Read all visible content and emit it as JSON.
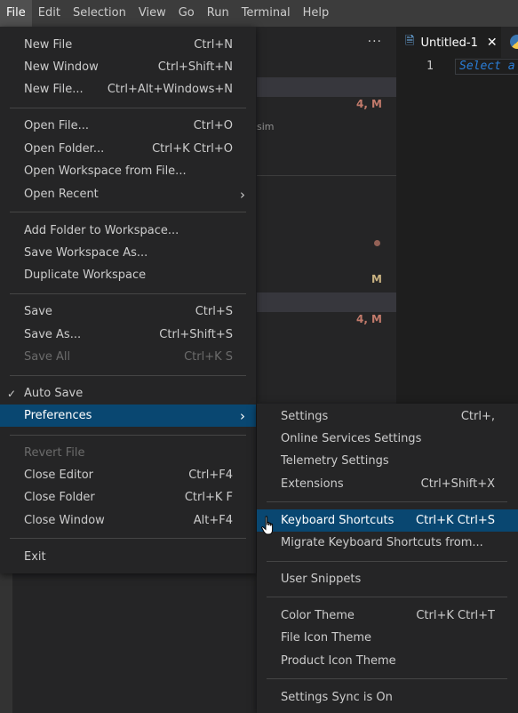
{
  "menubar": {
    "items": [
      "File",
      "Edit",
      "Selection",
      "View",
      "Go",
      "Run",
      "Terminal",
      "Help"
    ]
  },
  "sidebar": {
    "more_icon": "ellipsis-icon",
    "fragment": "sim",
    "badges": {
      "b1": "4, M",
      "b2": "M",
      "b3": "4, M"
    }
  },
  "editor": {
    "tab_title": "Untitled-1",
    "tab_icon": "file-icon",
    "line_number": "1",
    "placeholder": "Select a"
  },
  "file_menu": {
    "new_file": {
      "label": "New File",
      "shortcut": "Ctrl+N"
    },
    "new_window": {
      "label": "New Window",
      "shortcut": "Ctrl+Shift+N"
    },
    "new_file_dots": {
      "label": "New File...",
      "shortcut": "Ctrl+Alt+Windows+N"
    },
    "open_file": {
      "label": "Open File...",
      "shortcut": "Ctrl+O"
    },
    "open_folder": {
      "label": "Open Folder...",
      "shortcut": "Ctrl+K Ctrl+O"
    },
    "open_workspace": {
      "label": "Open Workspace from File...",
      "shortcut": ""
    },
    "open_recent": {
      "label": "Open Recent",
      "shortcut": ""
    },
    "add_folder": {
      "label": "Add Folder to Workspace...",
      "shortcut": ""
    },
    "save_workspace_as": {
      "label": "Save Workspace As...",
      "shortcut": ""
    },
    "duplicate_workspace": {
      "label": "Duplicate Workspace",
      "shortcut": ""
    },
    "save": {
      "label": "Save",
      "shortcut": "Ctrl+S"
    },
    "save_as": {
      "label": "Save As...",
      "shortcut": "Ctrl+Shift+S"
    },
    "save_all": {
      "label": "Save All",
      "shortcut": "Ctrl+K S"
    },
    "auto_save": {
      "label": "Auto Save",
      "shortcut": ""
    },
    "preferences": {
      "label": "Preferences",
      "shortcut": ""
    },
    "revert_file": {
      "label": "Revert File",
      "shortcut": ""
    },
    "close_editor": {
      "label": "Close Editor",
      "shortcut": "Ctrl+F4"
    },
    "close_folder": {
      "label": "Close Folder",
      "shortcut": "Ctrl+K F"
    },
    "close_window": {
      "label": "Close Window",
      "shortcut": "Alt+F4"
    },
    "exit": {
      "label": "Exit",
      "shortcut": ""
    }
  },
  "preferences_menu": {
    "settings": {
      "label": "Settings",
      "shortcut": "Ctrl+,"
    },
    "online_services": {
      "label": "Online Services Settings",
      "shortcut": ""
    },
    "telemetry": {
      "label": "Telemetry Settings",
      "shortcut": ""
    },
    "extensions": {
      "label": "Extensions",
      "shortcut": "Ctrl+Shift+X"
    },
    "keyboard_shortcuts": {
      "label": "Keyboard Shortcuts",
      "shortcut": "Ctrl+K Ctrl+S"
    },
    "migrate_shortcuts": {
      "label": "Migrate Keyboard Shortcuts from...",
      "shortcut": ""
    },
    "user_snippets": {
      "label": "User Snippets",
      "shortcut": ""
    },
    "color_theme": {
      "label": "Color Theme",
      "shortcut": "Ctrl+K Ctrl+T"
    },
    "file_icon_theme": {
      "label": "File Icon Theme",
      "shortcut": ""
    },
    "product_icon_theme": {
      "label": "Product Icon Theme",
      "shortcut": ""
    },
    "settings_sync": {
      "label": "Settings Sync is On",
      "shortcut": ""
    }
  },
  "colors": {
    "highlight": "#094771",
    "menu_bg": "#252526",
    "badge_red": "#c27a6b",
    "badge_tan": "#c9b281"
  }
}
